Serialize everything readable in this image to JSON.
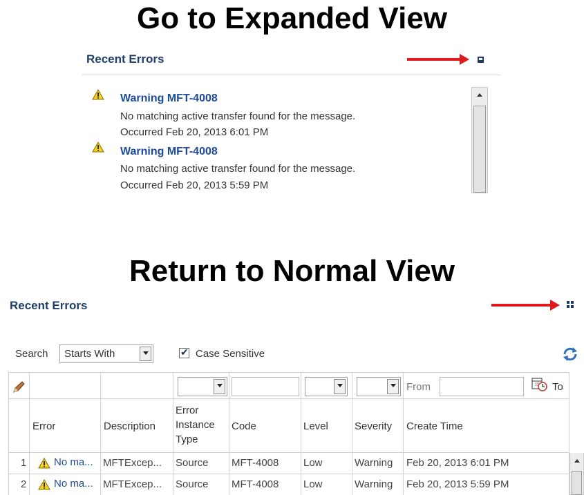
{
  "top_section": {
    "heading": "Go to Expanded View",
    "panel": {
      "title": "Recent Errors",
      "maximize_icon": "maximize-icon",
      "errors": [
        {
          "icon": "warning-icon",
          "title": "Warning MFT-4008",
          "message": "No matching active transfer found for the message.",
          "occurred_label": "Occurred",
          "occurred_value": "Feb 20, 2013 6:01 PM"
        },
        {
          "icon": "warning-icon",
          "title": "Warning MFT-4008",
          "message": "No matching active transfer found for the message.",
          "occurred_label": "Occurred",
          "occurred_value": "Feb 20, 2013 5:59 PM"
        }
      ]
    }
  },
  "bottom_section": {
    "heading": "Return to Normal View",
    "panel": {
      "title": "Recent Errors",
      "restore_icon": "restore-icon",
      "search": {
        "label": "Search",
        "operator": "Starts With",
        "case_sensitive_label": "Case Sensitive",
        "case_sensitive_checked": true,
        "refresh_icon": "refresh-icon"
      },
      "filter_row": {
        "edit_icon": "pencil-icon",
        "from_label": "From",
        "to_label": "To",
        "calendar_icon": "calendar-clock-icon"
      },
      "table": {
        "columns": [
          "Error",
          "Description",
          "Error Instance Type",
          "Code",
          "Level",
          "Severity",
          "Create Time"
        ],
        "rows": [
          {
            "num": "1",
            "error": "No ma...",
            "description": "MFTExcep...",
            "instance_type": "Source",
            "code": "MFT-4008",
            "level": "Low",
            "severity": "Warning",
            "create_time": "Feb 20, 2013 6:01 PM"
          },
          {
            "num": "2",
            "error": "No ma...",
            "description": "MFTExcep...",
            "instance_type": "Source",
            "code": "MFT-4008",
            "level": "Low",
            "severity": "Warning",
            "create_time": "Feb 20, 2013 5:59 PM"
          }
        ]
      }
    }
  },
  "colors": {
    "panel_title": "#203f6c",
    "link": "#1d4a9a",
    "arrow": "#e0191a",
    "warning": "#f2d21e"
  }
}
